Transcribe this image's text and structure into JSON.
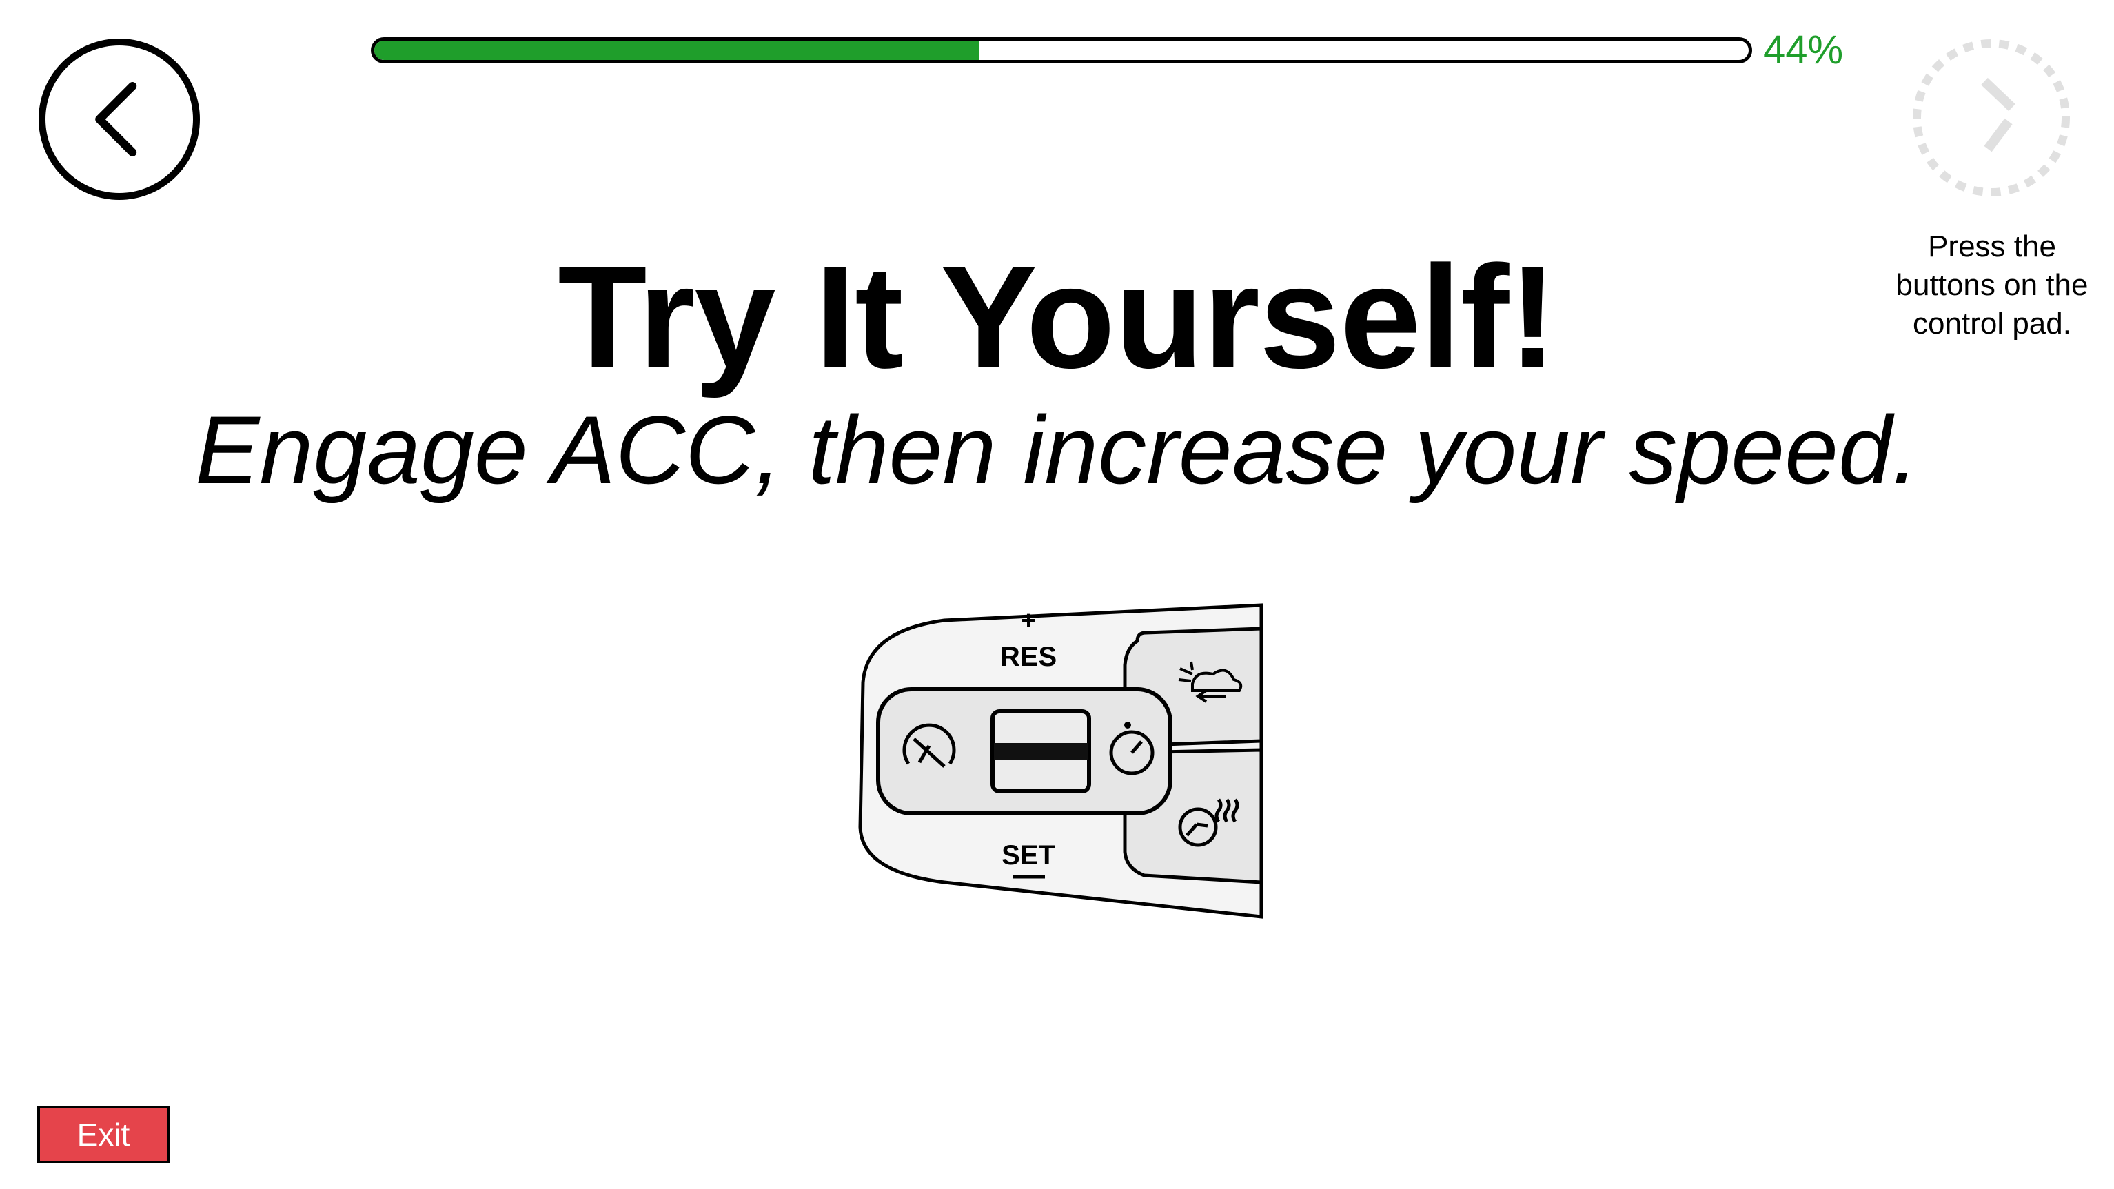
{
  "progress": {
    "value_percent": 44,
    "label": "44%",
    "color": "#1f9e2b"
  },
  "header": {
    "title": "Try It Yourself!",
    "subtitle": "Engage ACC, then increase your speed."
  },
  "hint": {
    "text": "Press the buttons on the control pad."
  },
  "control_pad": {
    "res_label": "RES",
    "set_label": "SET"
  },
  "exit": {
    "label": "Exit",
    "color": "#e5444b"
  },
  "icons": {
    "back": "chevron-left-icon",
    "timer": "countdown-timer-icon"
  }
}
